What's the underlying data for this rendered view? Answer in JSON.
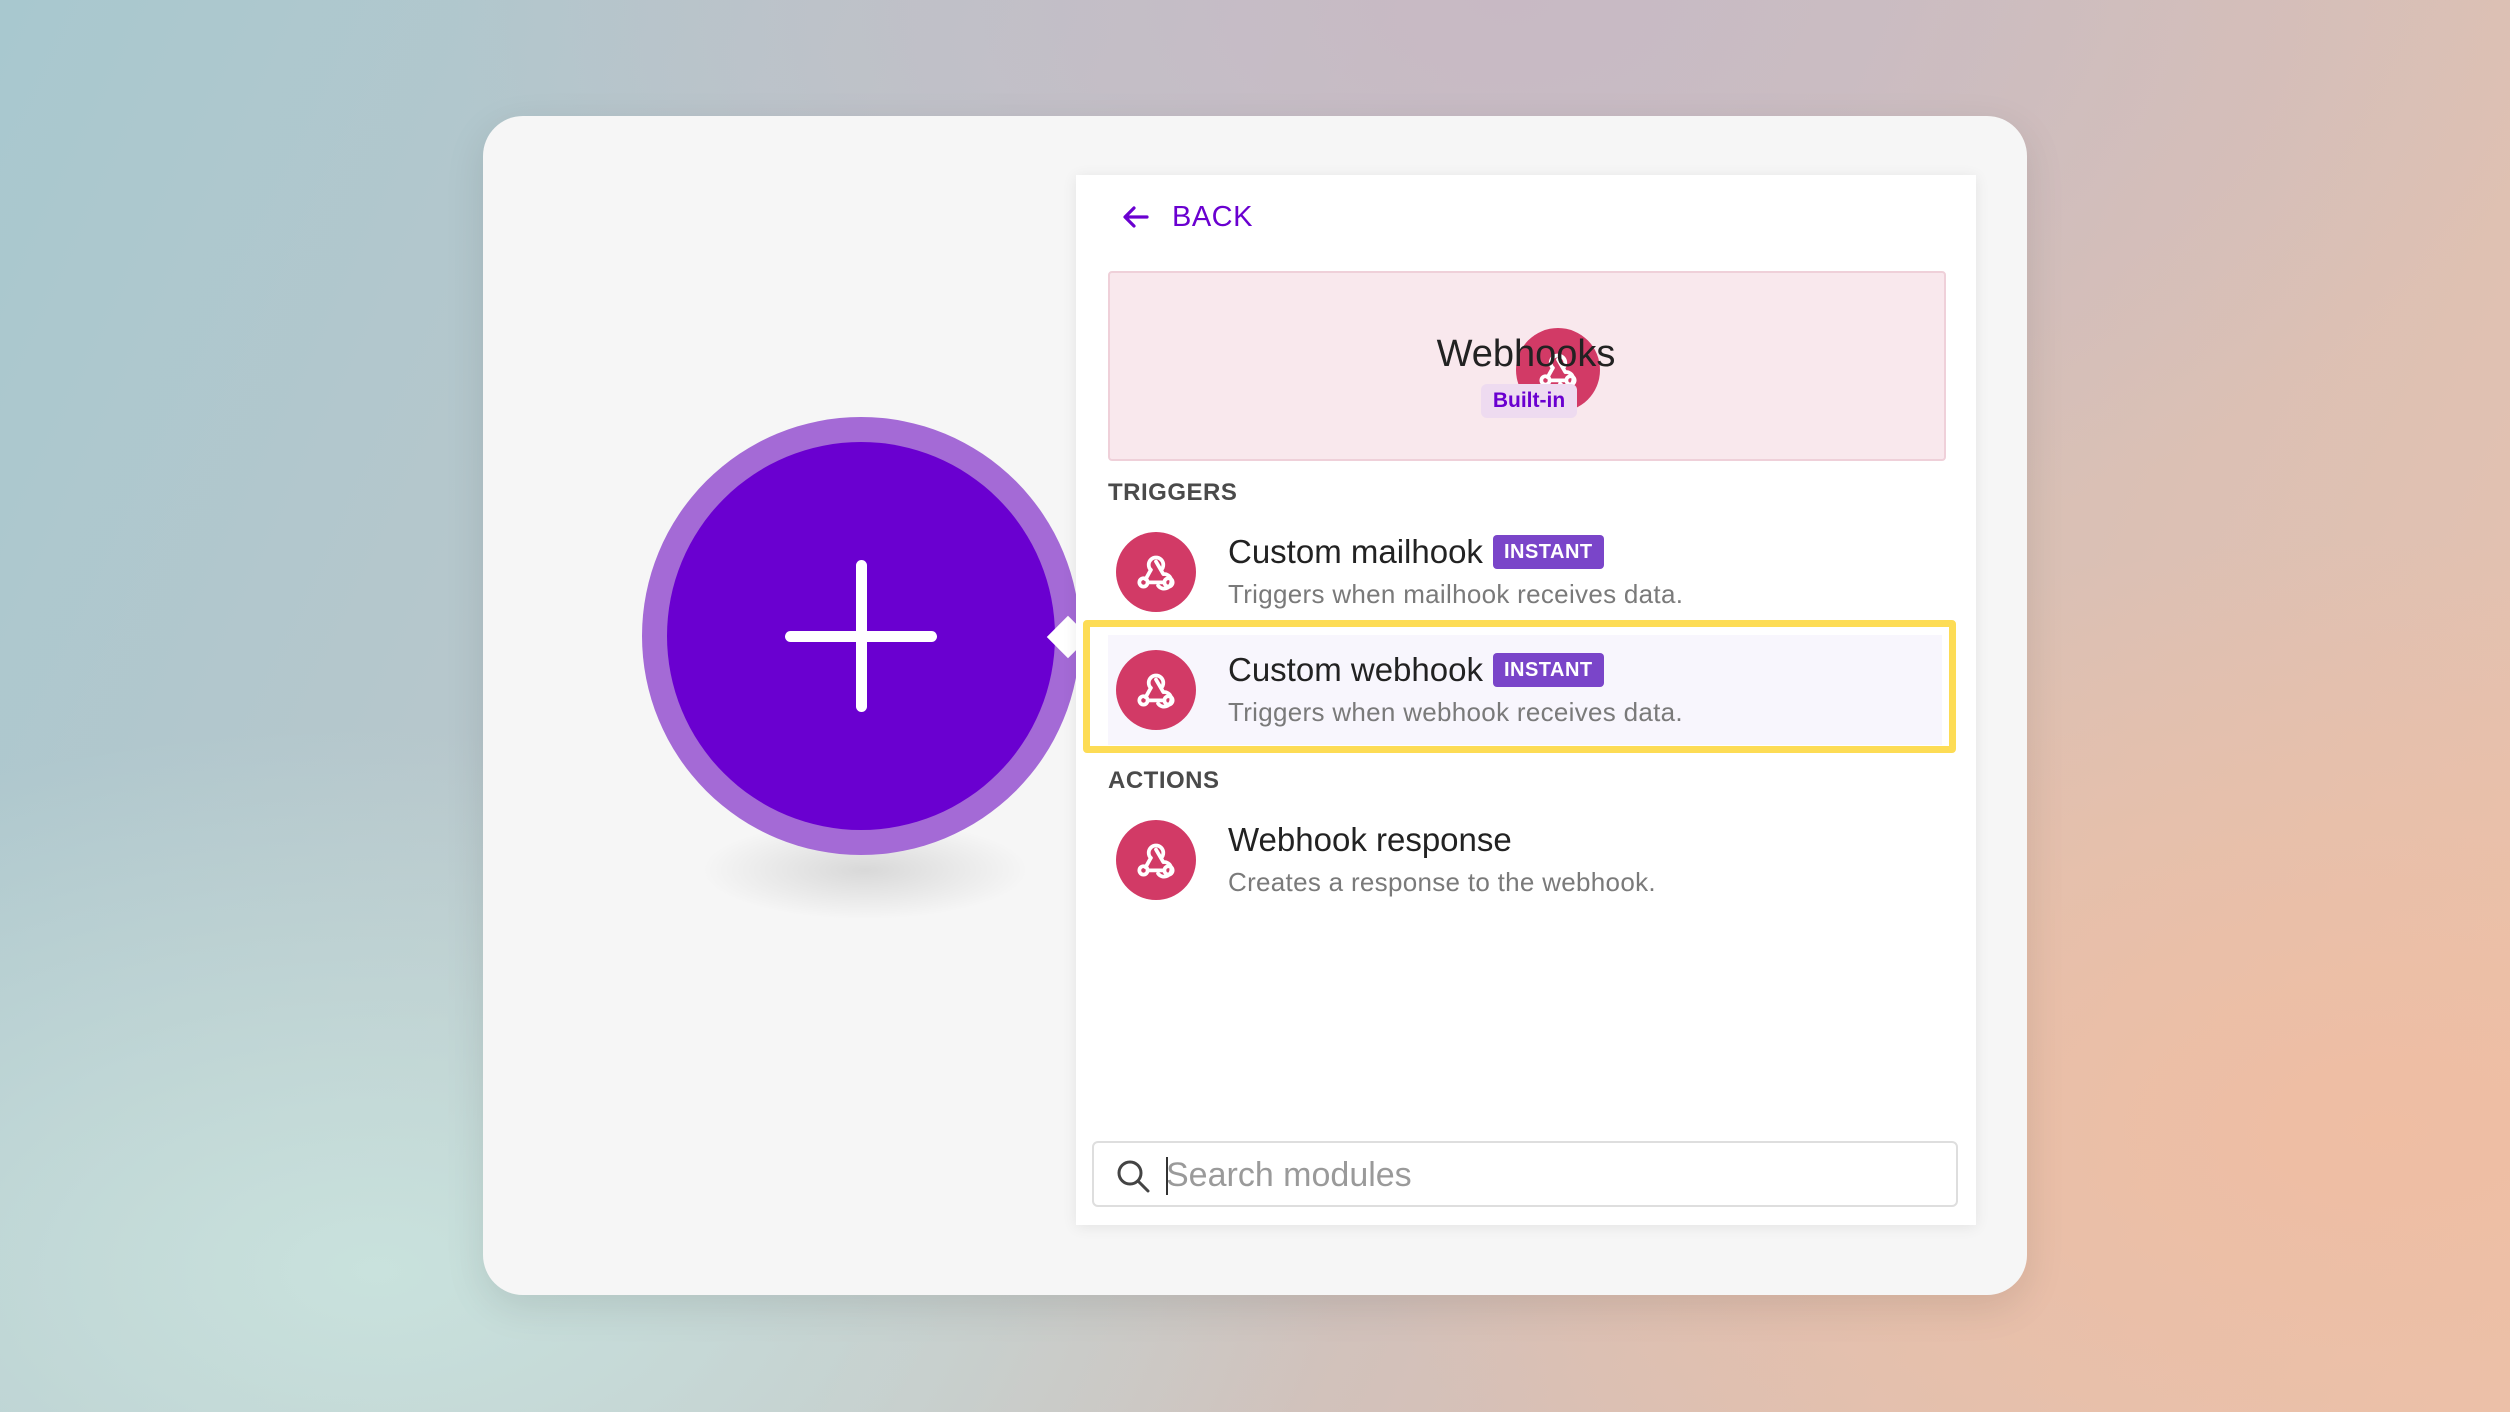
{
  "panel": {
    "back_label": "BACK",
    "app": {
      "name": "Webhooks",
      "badge": "Built-in",
      "icon": "webhook-icon"
    },
    "sections": {
      "triggers_title": "TRIGGERS",
      "actions_title": "ACTIONS"
    },
    "modules": [
      {
        "name": "Custom mailhook",
        "badge": "INSTANT",
        "description": "Triggers when mailhook receives data.",
        "icon": "webhook-icon",
        "selected": false
      },
      {
        "name": "Custom webhook",
        "badge": "INSTANT",
        "description": "Triggers when webhook receives data.",
        "icon": "webhook-icon",
        "selected": true
      },
      {
        "name": "Webhook response",
        "badge": "",
        "description": "Creates a response to the webhook.",
        "icon": "webhook-icon",
        "selected": false
      }
    ],
    "search": {
      "placeholder": "Search modules",
      "value": ""
    }
  },
  "colors": {
    "accent": "#6a00d0",
    "app_brand": "#d23a66",
    "badge": "#7a45c9",
    "highlight": "#fddc55"
  },
  "canvas": {
    "add_node_icon": "plus-icon"
  }
}
